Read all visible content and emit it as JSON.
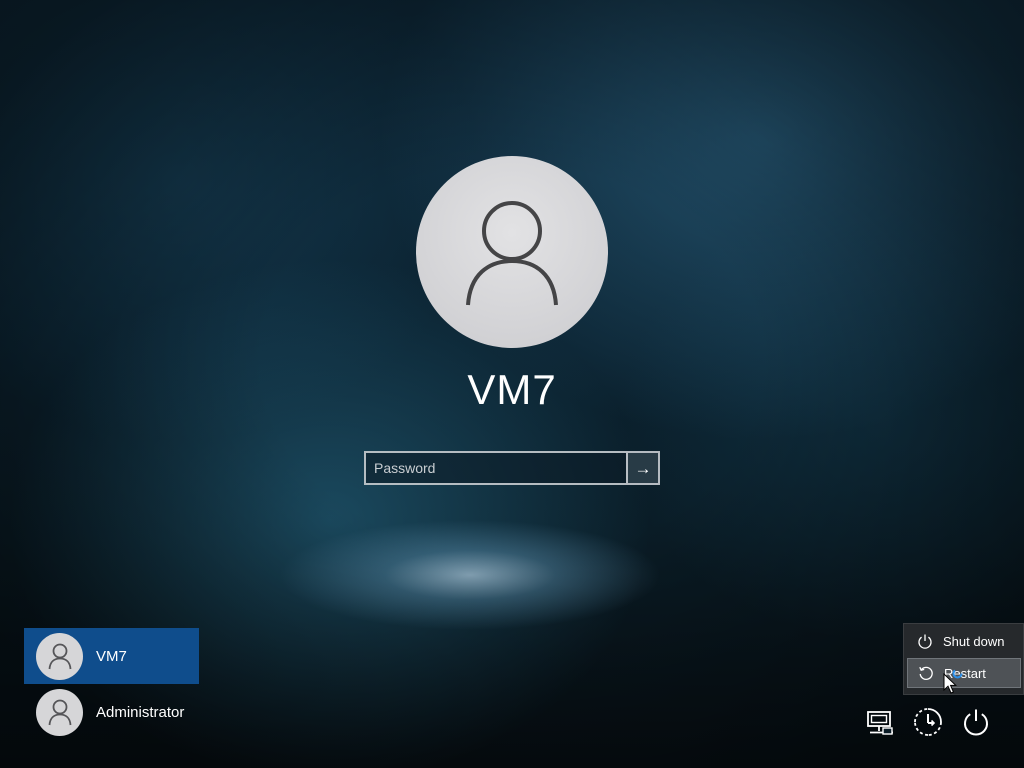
{
  "lock_screen": {
    "user_name": "VM7",
    "password_placeholder": "Password",
    "submit_icon": "arrow-right-icon"
  },
  "user_switcher": {
    "users": [
      {
        "label": "VM7",
        "selected": true,
        "icon": "user-avatar-icon"
      },
      {
        "label": "Administrator",
        "selected": false,
        "icon": "user-avatar-icon"
      }
    ]
  },
  "power_menu": {
    "items": [
      {
        "label": "Shut down",
        "icon": "power-icon"
      },
      {
        "label": "Restart",
        "icon": "restart-icon",
        "highlighted": true
      }
    ]
  },
  "tray": {
    "buttons": [
      {
        "name": "network-icon"
      },
      {
        "name": "ease-of-access-icon"
      },
      {
        "name": "power-icon"
      }
    ]
  },
  "colors": {
    "selected_user_bg": "#0f4d8c",
    "power_menu_bg": "#26292c",
    "restart_highlight_bg": "#4e5256",
    "avatar_bg": "#d6d6d8"
  }
}
